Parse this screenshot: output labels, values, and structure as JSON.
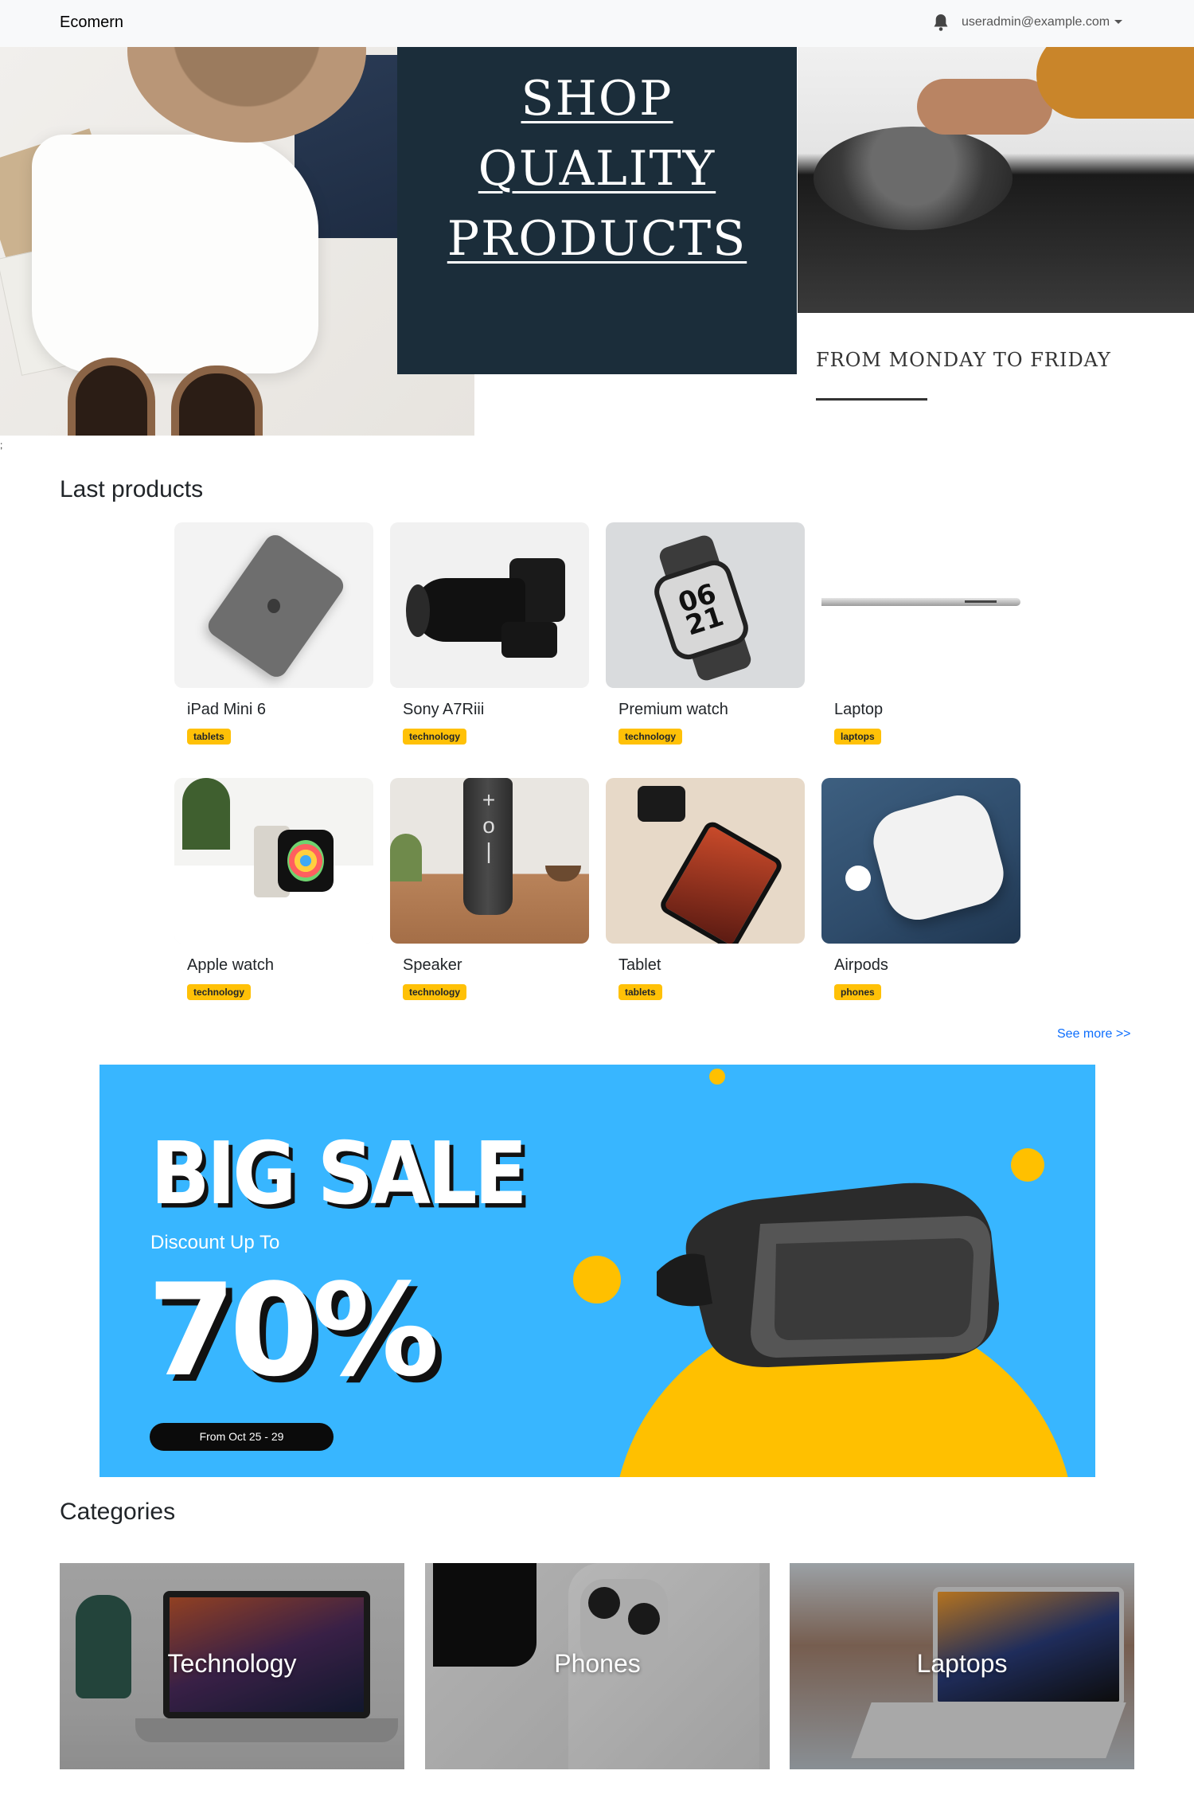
{
  "navbar": {
    "brand": "Ecomern",
    "user_email": "useradmin@example.com",
    "bell_icon": "bell-icon",
    "caret_icon": "caret-down-icon"
  },
  "hero": {
    "headline_lines": [
      "SHOP",
      "QUALITY",
      "PRODUCTS"
    ],
    "caption": "FROM MONDAY TO FRIDAY",
    "stray_text": ";"
  },
  "last_products": {
    "title": "Last products",
    "items": [
      {
        "name": "iPad Mini 6",
        "category": "tablets"
      },
      {
        "name": "Sony A7Riii",
        "category": "technology"
      },
      {
        "name": "Premium watch",
        "category": "technology"
      },
      {
        "name": "Laptop",
        "category": "laptops"
      },
      {
        "name": "Apple watch",
        "category": "technology"
      },
      {
        "name": "Speaker",
        "category": "technology"
      },
      {
        "name": "Tablet",
        "category": "tablets"
      },
      {
        "name": "Airpods",
        "category": "phones"
      }
    ],
    "see_more": "See more >>"
  },
  "banner": {
    "title": "BIG SALE",
    "subtitle": "Discount Up To",
    "percent": "70%",
    "dates": "From Oct 25 - 29",
    "colors": {
      "background": "#38b6ff",
      "accent": "#ffc000"
    }
  },
  "categories": {
    "title": "Categories",
    "items": [
      {
        "name": "Technology"
      },
      {
        "name": "Phones"
      },
      {
        "name": "Laptops"
      }
    ]
  },
  "colors": {
    "navbar_bg": "#f8f9fa",
    "badge": "#ffc107",
    "link": "#0d6efd",
    "hero_dark": "#1b2d3a"
  }
}
